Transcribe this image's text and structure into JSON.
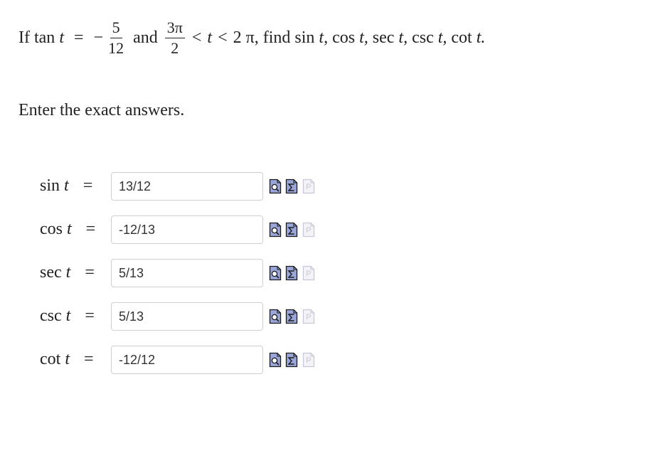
{
  "problem": {
    "if": "If",
    "tan": "tan",
    "t": "t",
    "eq": "=",
    "minus": "−",
    "frac1_num": "5",
    "frac1_den": "12",
    "and": "and",
    "frac2_num": "3π",
    "frac2_den": "2",
    "lt1": "<",
    "t2": "t",
    "lt2": "<",
    "upper": "2 π, find",
    "sin": "sin",
    "sin_t": "t,",
    "cos": "cos",
    "cos_t": "t,",
    "sec": "sec",
    "sec_t": "t,",
    "csc": "csc",
    "csc_t": "t,",
    "cot": "cot",
    "cot_t": "t."
  },
  "instruction": "Enter the exact answers.",
  "answers": [
    {
      "fn": "sin",
      "var": "t",
      "eq": "=",
      "value": "13/12"
    },
    {
      "fn": "cos",
      "var": "t",
      "eq": "=",
      "value": "-12/13"
    },
    {
      "fn": "sec",
      "var": "t",
      "eq": "=",
      "value": "5/13"
    },
    {
      "fn": "csc",
      "var": "t",
      "eq": "=",
      "value": "5/13"
    },
    {
      "fn": "cot",
      "var": "t",
      "eq": "=",
      "value": "-12/12"
    }
  ],
  "icons": {
    "preview": "magnifier-preview-icon",
    "equation": "sigma-equation-icon",
    "feedback": "page-feedback-icon",
    "accent": "#9aa6d8",
    "border": "#1a1a1a",
    "disabled": "#c8c8d8"
  }
}
